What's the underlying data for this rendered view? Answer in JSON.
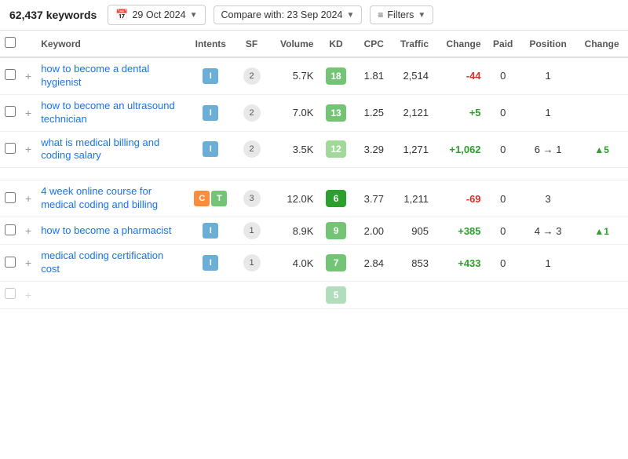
{
  "header": {
    "keyword_count": "62,437 keywords",
    "date_label": "29 Oct 2024",
    "compare_label": "Compare with: 23 Sep 2024",
    "filter_label": "Filters"
  },
  "columns": {
    "keyword": "Keyword",
    "intents": "Intents",
    "sf": "SF",
    "volume": "Volume",
    "kd": "KD",
    "cpc": "CPC",
    "traffic": "Traffic",
    "change": "Change",
    "paid": "Paid",
    "position": "Position",
    "change2": "Change"
  },
  "rows": [
    {
      "keyword": "how to become a dental hygienist",
      "intents": [
        "I"
      ],
      "sf": 2,
      "volume": "5.7K",
      "kd": 18,
      "kd_class": "kd-18",
      "cpc": "1.81",
      "traffic": "2,514",
      "change": "-44",
      "change_type": "neg",
      "paid": 0,
      "position": "1",
      "pos_change": "",
      "pos_arrow": ""
    },
    {
      "keyword": "how to become an ultrasound technician",
      "intents": [
        "I"
      ],
      "sf": 2,
      "volume": "7.0K",
      "kd": 13,
      "kd_class": "kd-13",
      "cpc": "1.25",
      "traffic": "2,121",
      "change": "+5",
      "change_type": "pos",
      "paid": 0,
      "position": "1",
      "pos_change": "",
      "pos_arrow": ""
    },
    {
      "keyword": "what is medical billing and coding salary",
      "intents": [
        "I"
      ],
      "sf": 2,
      "volume": "3.5K",
      "kd": 12,
      "kd_class": "kd-12",
      "cpc": "3.29",
      "traffic": "1,271",
      "change": "+1,062",
      "change_type": "pos",
      "paid": 0,
      "position": "6 → 1",
      "pos_change": "▲5",
      "pos_arrow": "up"
    },
    {
      "keyword": "4 week online course for medical coding and billing",
      "intents": [
        "C",
        "T"
      ],
      "sf": 3,
      "volume": "12.0K",
      "kd": 6,
      "kd_class": "kd-6",
      "cpc": "3.77",
      "traffic": "1,211",
      "change": "-69",
      "change_type": "neg",
      "paid": 0,
      "position": "3",
      "pos_change": "",
      "pos_arrow": ""
    },
    {
      "keyword": "how to become a pharmacist",
      "intents": [
        "I"
      ],
      "sf": 1,
      "volume": "8.9K",
      "kd": 9,
      "kd_class": "kd-9",
      "cpc": "2.00",
      "traffic": "905",
      "change": "+385",
      "change_type": "pos",
      "paid": 0,
      "position": "4 → 3",
      "pos_change": "▲1",
      "pos_arrow": "up"
    },
    {
      "keyword": "medical coding certification cost",
      "intents": [
        "I"
      ],
      "sf": 1,
      "volume": "4.0K",
      "kd": 7,
      "kd_class": "kd-7",
      "cpc": "2.84",
      "traffic": "853",
      "change": "+433",
      "change_type": "pos",
      "paid": 0,
      "position": "1",
      "pos_change": "",
      "pos_arrow": ""
    }
  ]
}
